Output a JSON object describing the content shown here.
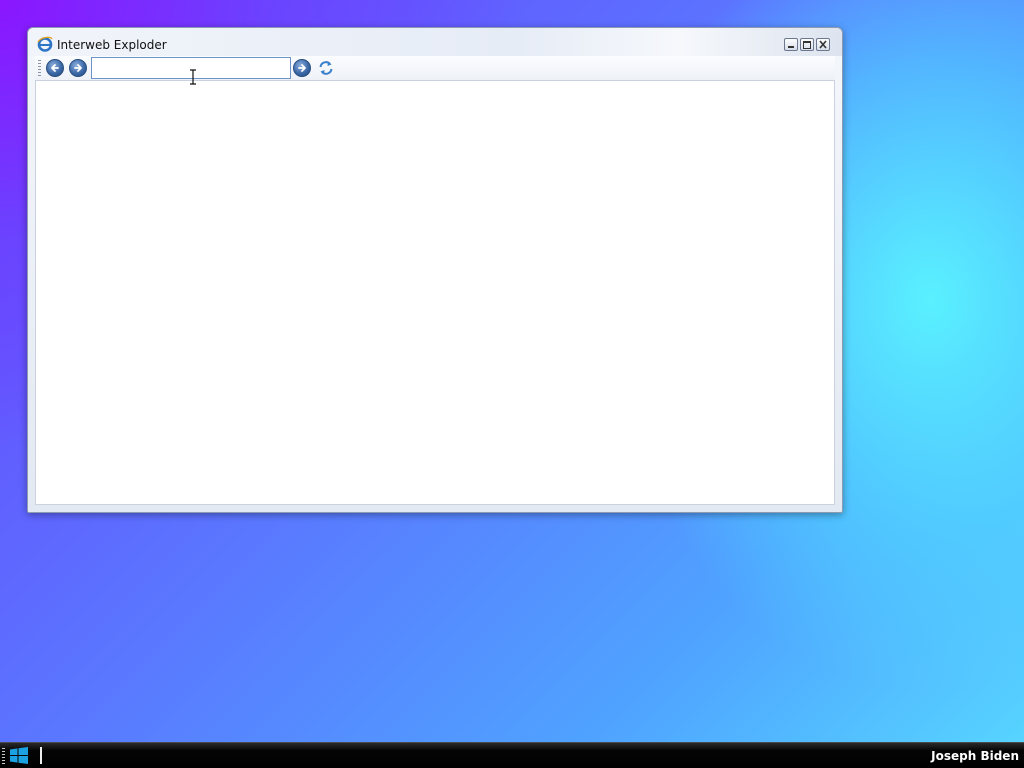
{
  "window": {
    "title": "Interweb Exploder",
    "icon": "ie-logo-icon",
    "controls": {
      "minimize": "minimize-icon",
      "maximize": "maximize-icon",
      "close": "close-icon"
    }
  },
  "toolbar": {
    "back_icon": "back-arrow-icon",
    "forward_icon": "forward-arrow-icon",
    "address": {
      "value": "",
      "placeholder": ""
    },
    "go_icon": "go-arrow-icon",
    "refresh_icon": "refresh-icon"
  },
  "content": {
    "text": ""
  },
  "taskbar": {
    "start_icon": "windows-logo-icon",
    "user_name": "Joseph Biden"
  },
  "colors": {
    "taskbar_bg": "#000000",
    "accent_blue": "#3d6aa8",
    "start_logo": "#1ba1e2"
  }
}
